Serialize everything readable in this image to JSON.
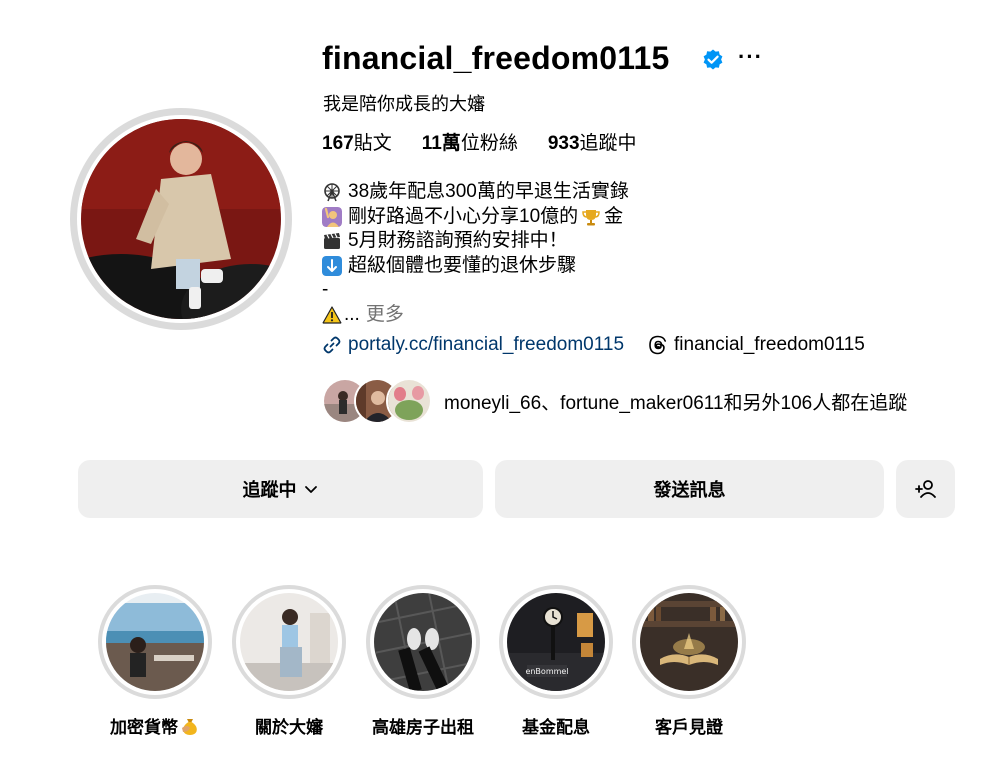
{
  "profile": {
    "username": "financial_freedom0115",
    "verified_icon": "verified-badge-icon",
    "more_label": "···",
    "full_name": "我是陪你成長的大嬸",
    "stats": {
      "posts_count": "167",
      "posts_label": "貼文",
      "followers_count": "11萬",
      "followers_label": "位粉絲",
      "following_count": "933",
      "following_label": "追蹤中"
    },
    "bio": {
      "line1": "38歲年配息300萬的早退生活實錄",
      "line2a": "剛好路過不小心分享10億的",
      "line2b": "金",
      "line3": "5月財務諮詢預約安排中！",
      "line4": "超級個體也要懂的退休步驟",
      "line5": "-",
      "line6": "...",
      "more": "更多"
    },
    "link_url": "portaly.cc/financial_freedom0115",
    "threads_handle": "financial_freedom0115",
    "followed_by": "moneyli_66、fortune_maker0611和另外106人都在追蹤"
  },
  "actions": {
    "following_label": "追蹤中",
    "message_label": "發送訊息"
  },
  "highlights": [
    {
      "label": "加密貨幣"
    },
    {
      "label": "關於大嬸"
    },
    {
      "label": "高雄房子出租"
    },
    {
      "label": "基金配息"
    },
    {
      "label": "客戶見證"
    }
  ],
  "colors": {
    "link": "#00376b",
    "verified": "#0095f6",
    "button_bg": "#efefef",
    "muted": "#737373"
  }
}
